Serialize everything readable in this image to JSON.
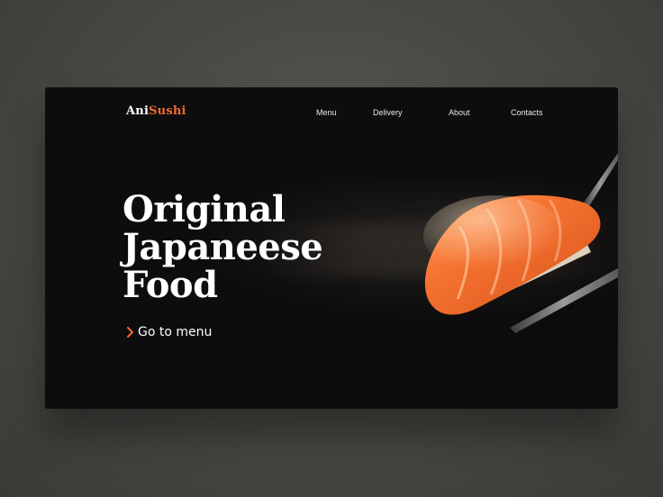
{
  "brand": {
    "name_part1": "Ani",
    "name_part2": "Sushi"
  },
  "nav": {
    "items": [
      {
        "label": "Menu"
      },
      {
        "label": "Delivery"
      },
      {
        "label": "About"
      },
      {
        "label": "Contacts"
      }
    ]
  },
  "hero": {
    "title_line1": "Original",
    "title_line2": "Japaneese",
    "title_line3": "Food",
    "cta_label": "Go to menu",
    "cta_icon": "chevron-right-icon"
  },
  "image": {
    "subject": "sushi-with-chopsticks"
  },
  "colors": {
    "accent": "#f26a2e",
    "card_bg": "#0d0d0d",
    "page_bg": "#4a4945",
    "text": "#ffffff"
  }
}
